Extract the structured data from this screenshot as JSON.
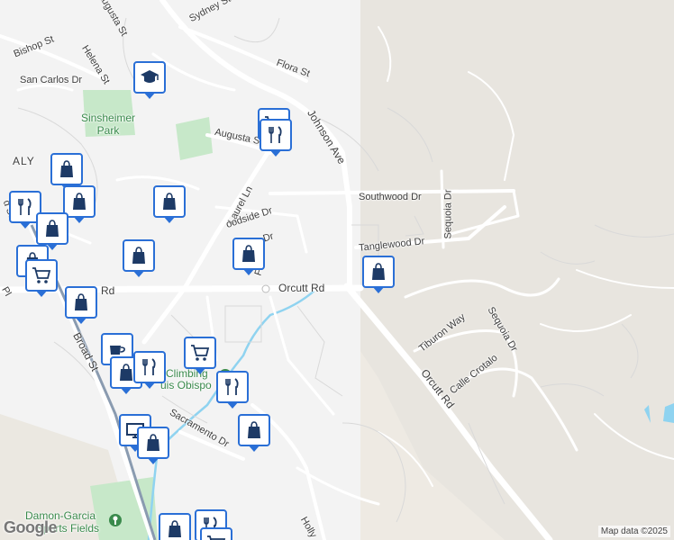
{
  "streets": {
    "sydney": "Sydney St",
    "augusta_top": "Augusta St",
    "bishop": "Bishop St",
    "helena": "Helena St",
    "san_carlos": "San Carlos Dr",
    "flora": "Flora St",
    "johnson": "Johnson Ave",
    "augusta_mid": "Augusta S",
    "italy": "ALY",
    "laurel": "Laurel Ln",
    "southwood": "Southwood Dr",
    "sequoia_upper": "Sequoia Dr",
    "woodside": "oodside Dr",
    "fa": "Fa",
    "dr": "Dr",
    "tanglewood": "Tanglewood Dr",
    "orcutt_h": "Orcutt Rd",
    "orcutt_h_left": "Rd",
    "broad_st_top": "d St",
    "pl": "Pl",
    "tiburon": "Tiburon Way",
    "sequoia_lower": "Sequoia Dr",
    "calle_crotalo": "Calle Crotalo",
    "orcutt_diag": "Orcutt Rd",
    "broad": "Broad St",
    "sacramento": "Sacramento Dr",
    "holly": "Holly"
  },
  "places": {
    "sinsheimer_park": "Sinsheimer\nPark",
    "climbing_line1": "Climbing",
    "climbing_line2": "uis Obispo",
    "damon_line1": "Damon-Garcia",
    "damon_line2": "Sports Fields"
  },
  "branding": {
    "logo": "Google",
    "attribution": "Map data ©2025"
  },
  "colors": {
    "background": "#f1f1f1",
    "park": "#c7e8c9",
    "water": "#8fd3f0",
    "road": "#ffffff",
    "rail": "#8a9bb0",
    "pin_fill": "#ffffff",
    "pin_border": "#2a6fd6",
    "pin_icon": "#1d3a66"
  },
  "markers": [
    {
      "type": "school-icon"
    },
    {
      "type": "cart-icon"
    },
    {
      "type": "restaurant-icon"
    },
    {
      "type": "shopping-bag-icon"
    },
    {
      "type": "restaurant-icon"
    },
    {
      "type": "shopping-bag-icon"
    },
    {
      "type": "shopping-bag-icon"
    },
    {
      "type": "shopping-bag-icon"
    },
    {
      "type": "shopping-bag-icon"
    },
    {
      "type": "shopping-bag-icon"
    },
    {
      "type": "shopping-bag-icon"
    },
    {
      "type": "shopping-bag-icon"
    },
    {
      "type": "cart-icon"
    },
    {
      "type": "shopping-bag-icon"
    },
    {
      "type": "cafe-icon"
    },
    {
      "type": "cart-icon"
    },
    {
      "type": "shopping-bag-icon"
    },
    {
      "type": "restaurant-icon"
    },
    {
      "type": "restaurant-icon"
    },
    {
      "type": "shopping-bag-icon"
    },
    {
      "type": "monitor-icon"
    },
    {
      "type": "shopping-bag-icon"
    },
    {
      "type": "shopping-bag-icon"
    },
    {
      "type": "restaurant-icon"
    },
    {
      "type": "cart-icon"
    }
  ]
}
